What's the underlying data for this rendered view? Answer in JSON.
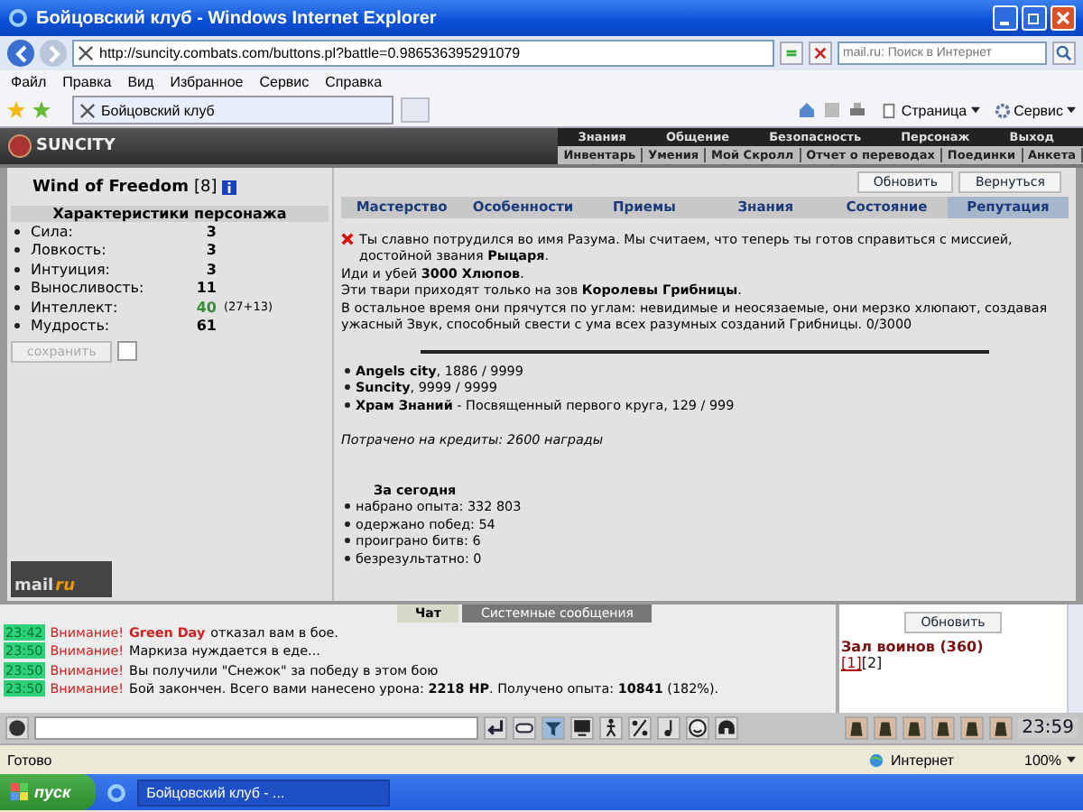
{
  "window": {
    "title": "Бойцовский клуб - Windows Internet Explorer"
  },
  "address_bar": {
    "url": "http://suncity.combats.com/buttons.pl?battle=0.986536395291079",
    "search_placeholder": "mail.ru: Поиск в Интернет"
  },
  "menu": [
    "Файл",
    "Правка",
    "Вид",
    "Избранное",
    "Сервис",
    "Справка"
  ],
  "browser_tab": {
    "title": "Бойцовский клуб"
  },
  "command_bar": [
    "Страница",
    "Сервис"
  ],
  "game_header": {
    "logo": "SUNCITY",
    "nav": [
      "Знания",
      "Общение",
      "Безопасность",
      "Персонаж",
      "Выход"
    ],
    "subnav": [
      "Инвентарь",
      "Умения",
      "Мой Скролл",
      "Отчет о переводах",
      "Поединки",
      "Анкета"
    ]
  },
  "character": {
    "name": "Wind of Freedom",
    "level": "[8]"
  },
  "stats": {
    "title": "Характеристики персонажа",
    "items": [
      {
        "label": "Сила:",
        "value": "3",
        "boosted": false
      },
      {
        "label": "Ловкость:",
        "value": "3",
        "boosted": false
      },
      {
        "label": "Интуиция:",
        "value": "3",
        "boosted": false
      },
      {
        "label": "Выносливость:",
        "value": "11",
        "boosted": false
      },
      {
        "label": "Интеллект:",
        "value": "40",
        "boosted": true,
        "extra": "(27+13)"
      },
      {
        "label": "Мудрость:",
        "value": "61",
        "boosted": false
      }
    ],
    "save_button": {
      "label": "сохранить",
      "disabled": true
    },
    "checkbox": {
      "checked": false
    }
  },
  "counter": {
    "brand": "mail",
    "suffix": "ru"
  },
  "buttons": [
    "Обновить",
    "Вернуться"
  ],
  "tabs": [
    {
      "label": "Мастерство",
      "selected": false
    },
    {
      "label": "Особенности",
      "selected": false
    },
    {
      "label": "Приемы",
      "selected": false
    },
    {
      "label": "Знания",
      "selected": false
    },
    {
      "label": "Состояние",
      "selected": false
    },
    {
      "label": "Репутация",
      "selected": true
    }
  ],
  "quest": [
    "Ты славно потрудился во имя Разума. Мы считаем, что теперь ты готов справиться с миссией, достойной звания **Рыцаря**.",
    "Иди и убей **3000 Хлюпов**.",
    "Эти твари приходят только на зов **Королевы Грибницы**.",
    "В остальное время они прячутся по углам: невидимые и неосязаемые, они мерзко хлюпают, создавая ужасный Звук, способный свести с ума всех разумных созданий Грибницы. 0/3000"
  ],
  "reputation": [
    "**Angels city**, 1886 / 9999",
    "**Suncity**, 9999 / 9999",
    "**Храм Знаний** - Посвященный первого круга, 129 / 999"
  ],
  "spent": "Потрачено на кредиты: 2600 награды",
  "today": {
    "title": "За сегодня",
    "items": [
      "набрано опыта: 332 803",
      "одержано побед: 54",
      "проиграно битв: 6",
      "безрезультатно: 0"
    ]
  },
  "chat": {
    "tabs": [
      {
        "label": "Чат",
        "selected": true
      },
      {
        "label": "Системные сообщения",
        "selected": false
      }
    ],
    "messages": [
      {
        "time": "23:42",
        "prefix": "Внимание!",
        "name": "Green Day",
        "text": "отказал вам в бое."
      },
      {
        "time": "23:50",
        "prefix": "Внимание!",
        "text": "Маркиза нуждается в еде..."
      },
      {
        "time": "23:50",
        "prefix": "Внимание!",
        "text": "Вы получили \"Снежок\" за победу в этом бою"
      },
      {
        "time": "23:50",
        "prefix": "Внимание!",
        "text": "Бой закончен. Всего вами нанесено урона: **2218 HP**. Получено опыта: **10841** (182%)."
      }
    ]
  },
  "room": {
    "button": "Обновить",
    "title": "Зал воинов (360)",
    "pages": [
      {
        "label": "[1]",
        "selected": true
      },
      {
        "label": "[2]",
        "selected": false
      }
    ]
  },
  "clock": "23:59",
  "status_bar": {
    "text": "Готово",
    "zone": "Интернет",
    "zoom": "100%"
  },
  "taskbar": {
    "start": "пуск",
    "task": "Бойцовский клуб - ..."
  }
}
